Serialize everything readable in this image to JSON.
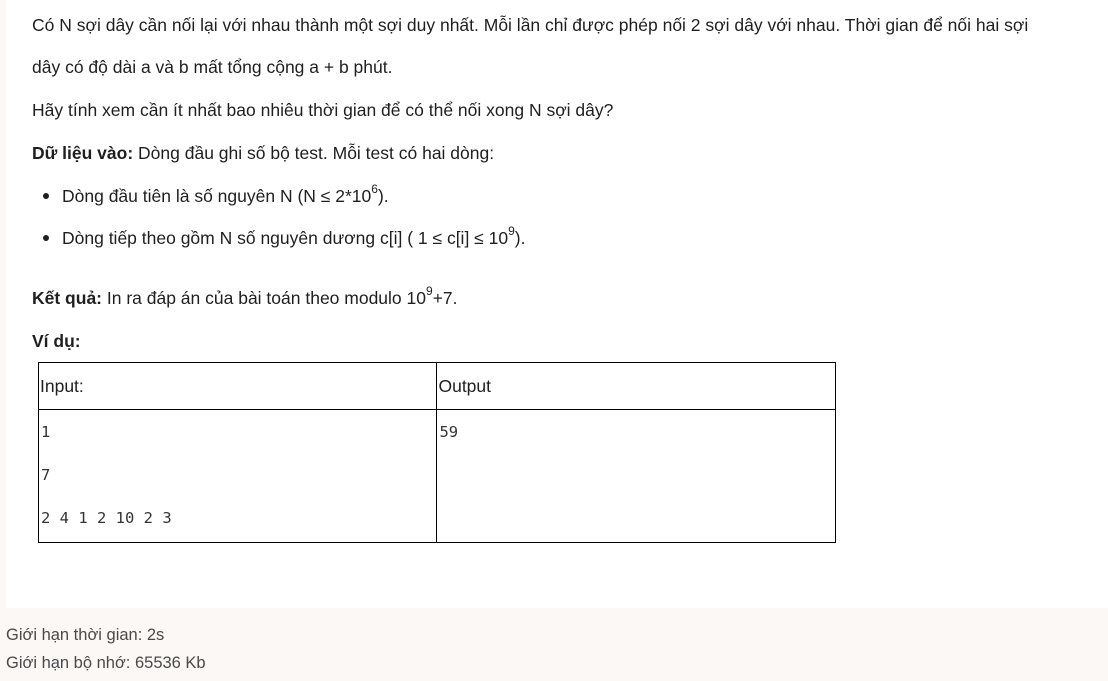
{
  "problem": {
    "paragraph1_line1": "Có N sợi dây cần nối lại với nhau thành một sợi duy nhất. Mỗi lần chỉ được phép nối 2 sợi dây với nhau. Thời gian để nối hai sợi",
    "paragraph1_line2": "dây có độ dài a và b mất tổng cộng a + b phút.",
    "question": "Hãy tính xem cần ít nhất bao nhiêu thời gian để có thể nối xong N sợi dây?",
    "input_label": "Dữ liệu vào:",
    "input_desc": " Dòng đầu ghi số bộ test. Mỗi test có hai dòng:",
    "bullet1_text": "Dòng đầu tiên là số nguyên N (N ≤ 2*10",
    "bullet1_sup": "6",
    "bullet1_end": ").",
    "bullet2_text": "Dòng tiếp theo gồm N số nguyên dương c[i] ( 1 ≤ c[i] ≤ 10",
    "bullet2_sup": "9",
    "bullet2_end": ").",
    "output_label": "Kết quả:",
    "output_desc": " In ra đáp án của bài toán theo modulo 10",
    "output_sup": "9",
    "output_end": "+7.",
    "example_label": "Ví dụ:"
  },
  "example_table": {
    "header_input": "Input:",
    "header_output": "Output",
    "input_lines": [
      "1",
      "7",
      "2 4 1 2 10 2 3"
    ],
    "output_lines": [
      "59"
    ]
  },
  "footer": {
    "time_limit": "Giới hạn thời gian: 2s",
    "memory_limit": "Giới hạn bộ nhớ: 65536 Kb"
  }
}
